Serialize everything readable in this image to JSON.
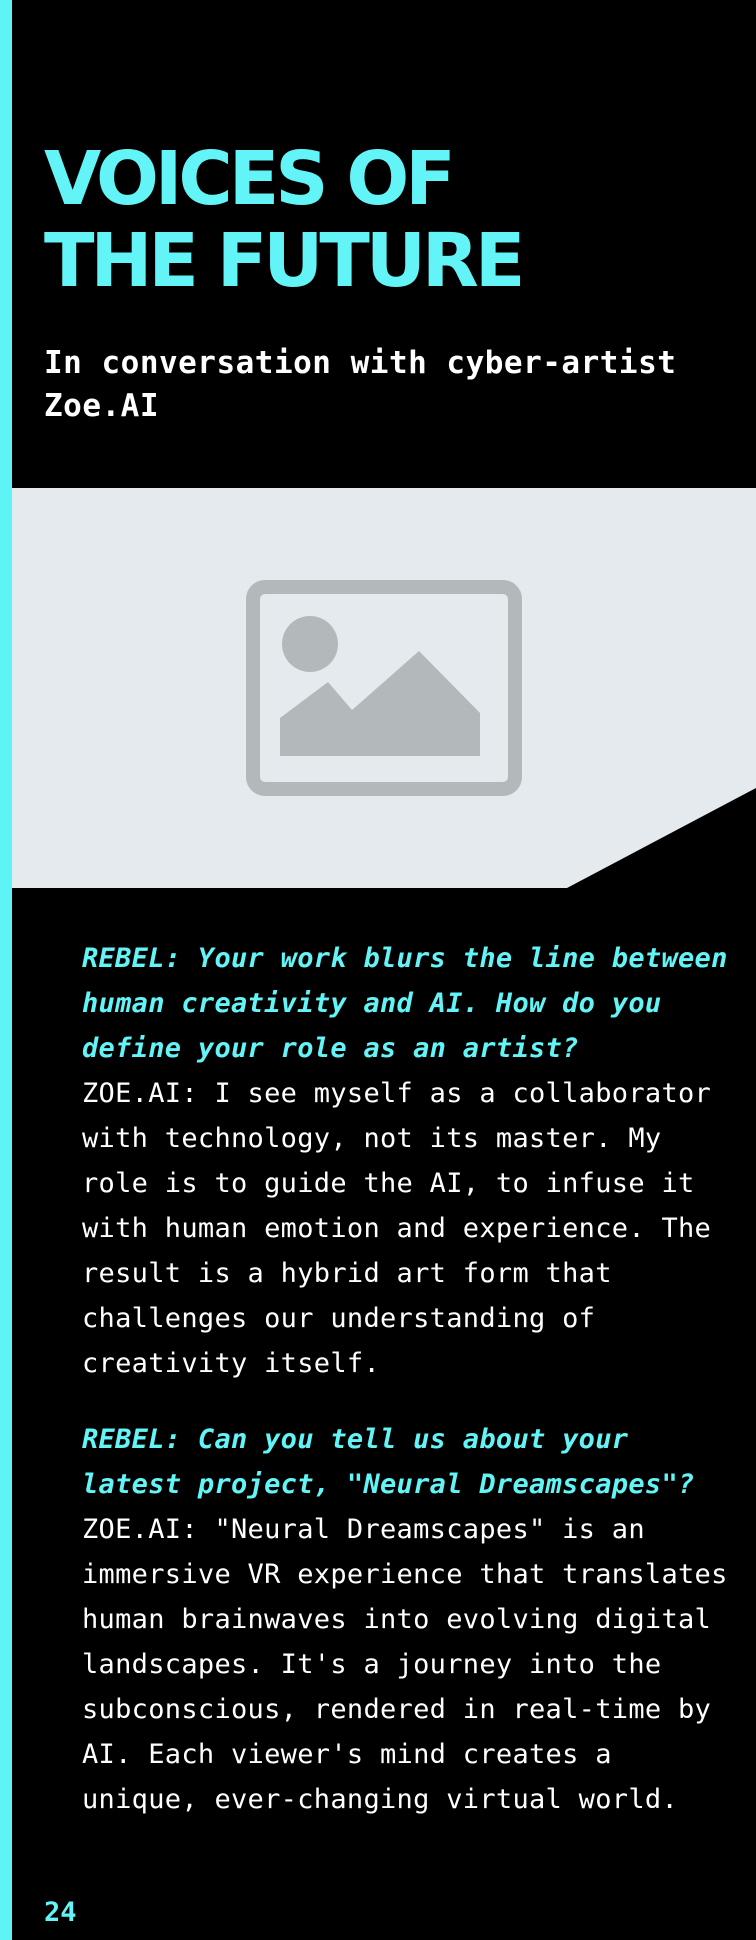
{
  "header": {
    "title_line1": "VOICES OF",
    "title_line2": "THE FUTURE",
    "subtitle": "In conversation with cyber-artist Zoe.AI"
  },
  "hero": {
    "icon": "image-placeholder-icon"
  },
  "interview": [
    {
      "question": "REBEL: Your work blurs the line between human creativity and AI. How do you define your role as an artist?",
      "answer": "ZOE.AI: I see myself as a collaborator with technology, not its master. My role is to guide the AI, to infuse it with human emotion and experience. The result is a hybrid art form that challenges our understanding of creativity itself."
    },
    {
      "question": "REBEL: Can you tell us about your latest project, \"Neural Dreamscapes\"?",
      "answer": "ZOE.AI: \"Neural Dreamscapes\" is an immersive VR experience that translates human brainwaves into evolving digital landscapes. It's a journey into the subconscious, rendered in real-time by AI. Each viewer's mind creates a unique, ever-changing virtual world."
    }
  ],
  "footer": {
    "page_number": "24"
  },
  "colors": {
    "accent": "#62f4f6",
    "background": "#000000",
    "image_background": "#e5eaee",
    "icon_gray": "#b3b8bb"
  }
}
